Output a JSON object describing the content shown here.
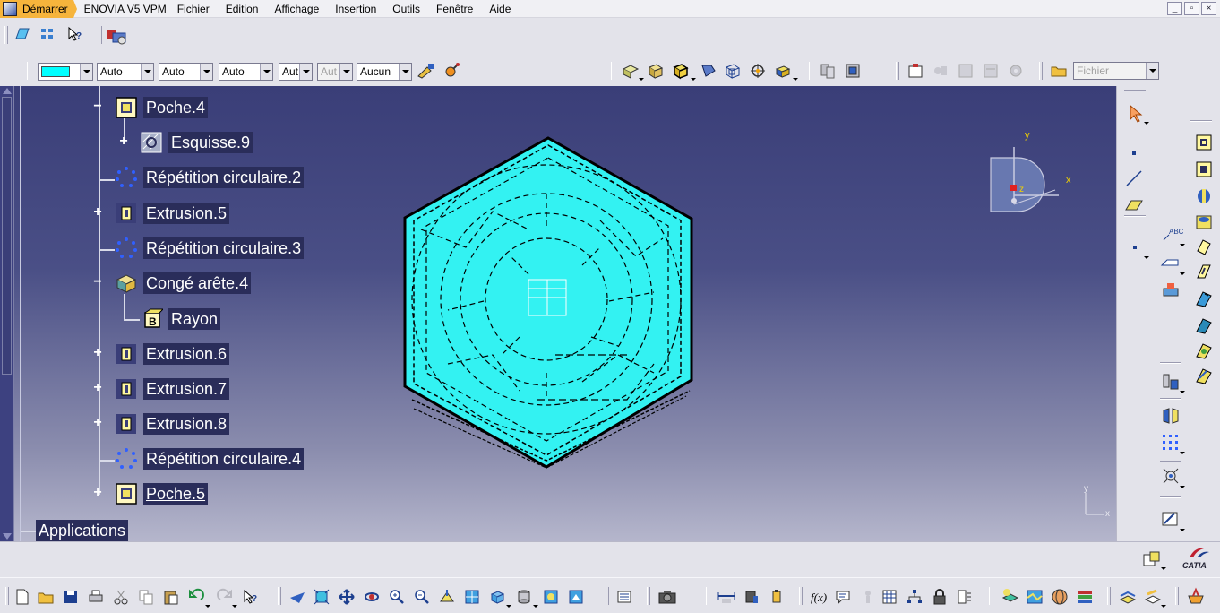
{
  "menubar": {
    "items": [
      "Démarrer",
      "ENOVIA V5 VPM",
      "Fichier",
      "Edition",
      "Affichage",
      "Insertion",
      "Outils",
      "Fenêtre",
      "Aide"
    ]
  },
  "window_controls": {
    "minimize": "_",
    "restore": "▫",
    "close": "×"
  },
  "properties_toolbar": {
    "color_value": "#00ffff",
    "transparency": "Auto",
    "line_thickness": "Auto",
    "line_type": "Auto",
    "point_type": "Aut",
    "layer_disabled": "Aut",
    "layer": "Aucun"
  },
  "file_combo": {
    "placeholder": "Fichier"
  },
  "tree": {
    "items": [
      {
        "label": "Poche.4",
        "icon": "pocket-icon",
        "expander": "−"
      },
      {
        "label": "Esquisse.9",
        "icon": "sketch-icon",
        "expander": "+"
      },
      {
        "label": "Répétition circulaire.2",
        "icon": "circular-pattern-icon",
        "expander": ""
      },
      {
        "label": "Extrusion.5",
        "icon": "pad-icon",
        "expander": "+"
      },
      {
        "label": "Répétition circulaire.3",
        "icon": "circular-pattern-icon",
        "expander": ""
      },
      {
        "label": "Congé arête.4",
        "icon": "edge-fillet-icon",
        "expander": "−"
      },
      {
        "label": "Rayon",
        "icon": "radius-icon",
        "expander": ""
      },
      {
        "label": "Extrusion.6",
        "icon": "pad-icon",
        "expander": "+"
      },
      {
        "label": "Extrusion.7",
        "icon": "pad-icon",
        "expander": "+"
      },
      {
        "label": "Extrusion.8",
        "icon": "pad-icon",
        "expander": "+"
      },
      {
        "label": "Répétition circulaire.4",
        "icon": "circular-pattern-icon",
        "expander": ""
      },
      {
        "label": "Poche.5",
        "icon": "pocket-icon",
        "expander": "+"
      }
    ],
    "applications": "Applications"
  },
  "compass": {
    "x": "x",
    "y": "y",
    "z": "z"
  },
  "axis_triad": {
    "x": "x",
    "y": "y"
  },
  "brand": {
    "name": "CATIA"
  },
  "colors": {
    "accent": "#f6b43c",
    "part": "#33f2f2",
    "background_top": "#3a3e78",
    "background_bottom": "#b5b6cc"
  }
}
